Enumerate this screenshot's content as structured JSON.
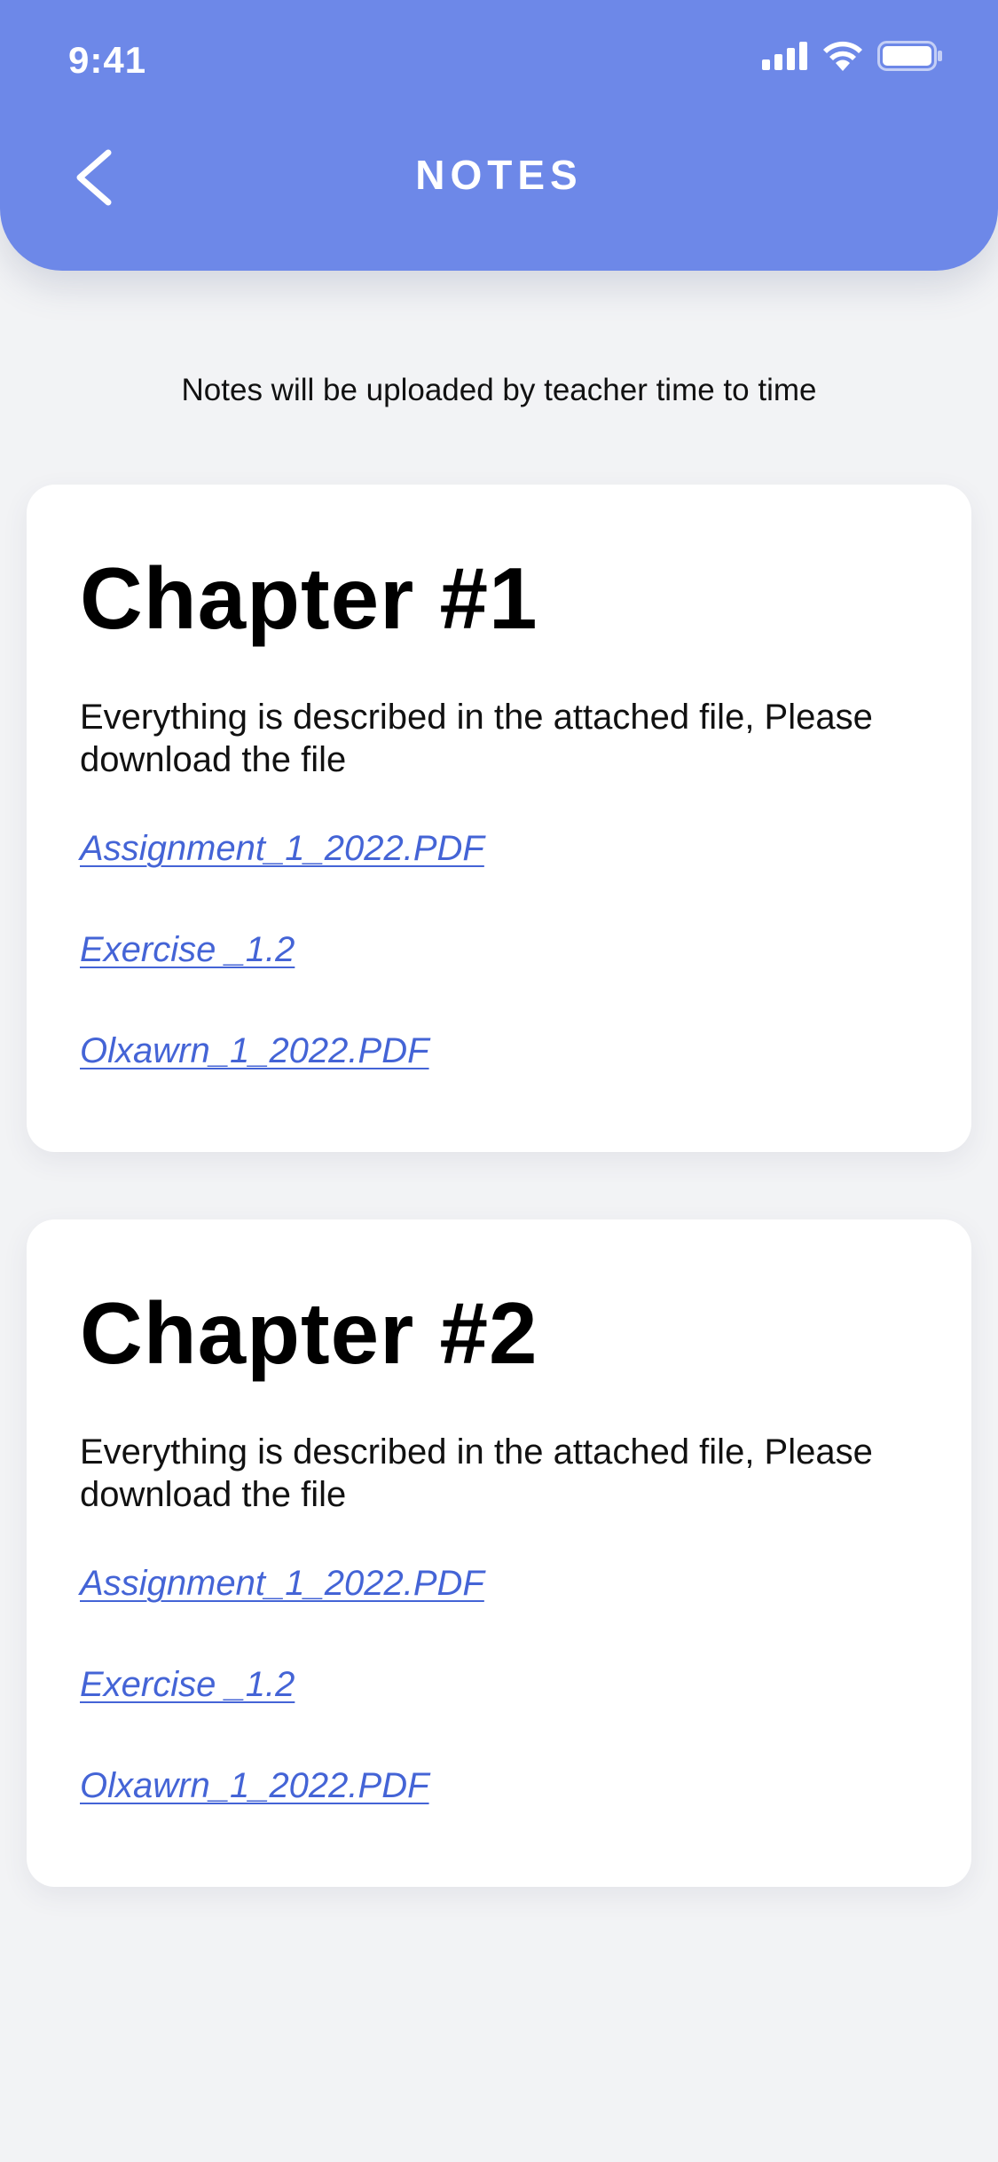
{
  "status_bar": {
    "time": "9:41",
    "icons": [
      "signal-icon",
      "wifi-icon",
      "battery-icon"
    ]
  },
  "header": {
    "back_icon": "chevron-left-icon",
    "title": "NOTES"
  },
  "subtitle": "Notes will be uploaded by teacher time to time",
  "colors": {
    "header_bg": "#6d88e8",
    "link": "#4464d6",
    "page_bg": "#f2f3f5"
  },
  "chapters": [
    {
      "title": "Chapter #1",
      "description": "Everything is described in the attached file, Please download the file",
      "files": [
        "Assignment_1_2022.PDF",
        "Exercise _1.2",
        "Olxawrn_1_2022.PDF"
      ]
    },
    {
      "title": "Chapter #2",
      "description": "Everything is described in the attached file, Please download the file",
      "files": [
        "Assignment_1_2022.PDF",
        "Exercise _1.2",
        "Olxawrn_1_2022.PDF"
      ]
    }
  ]
}
